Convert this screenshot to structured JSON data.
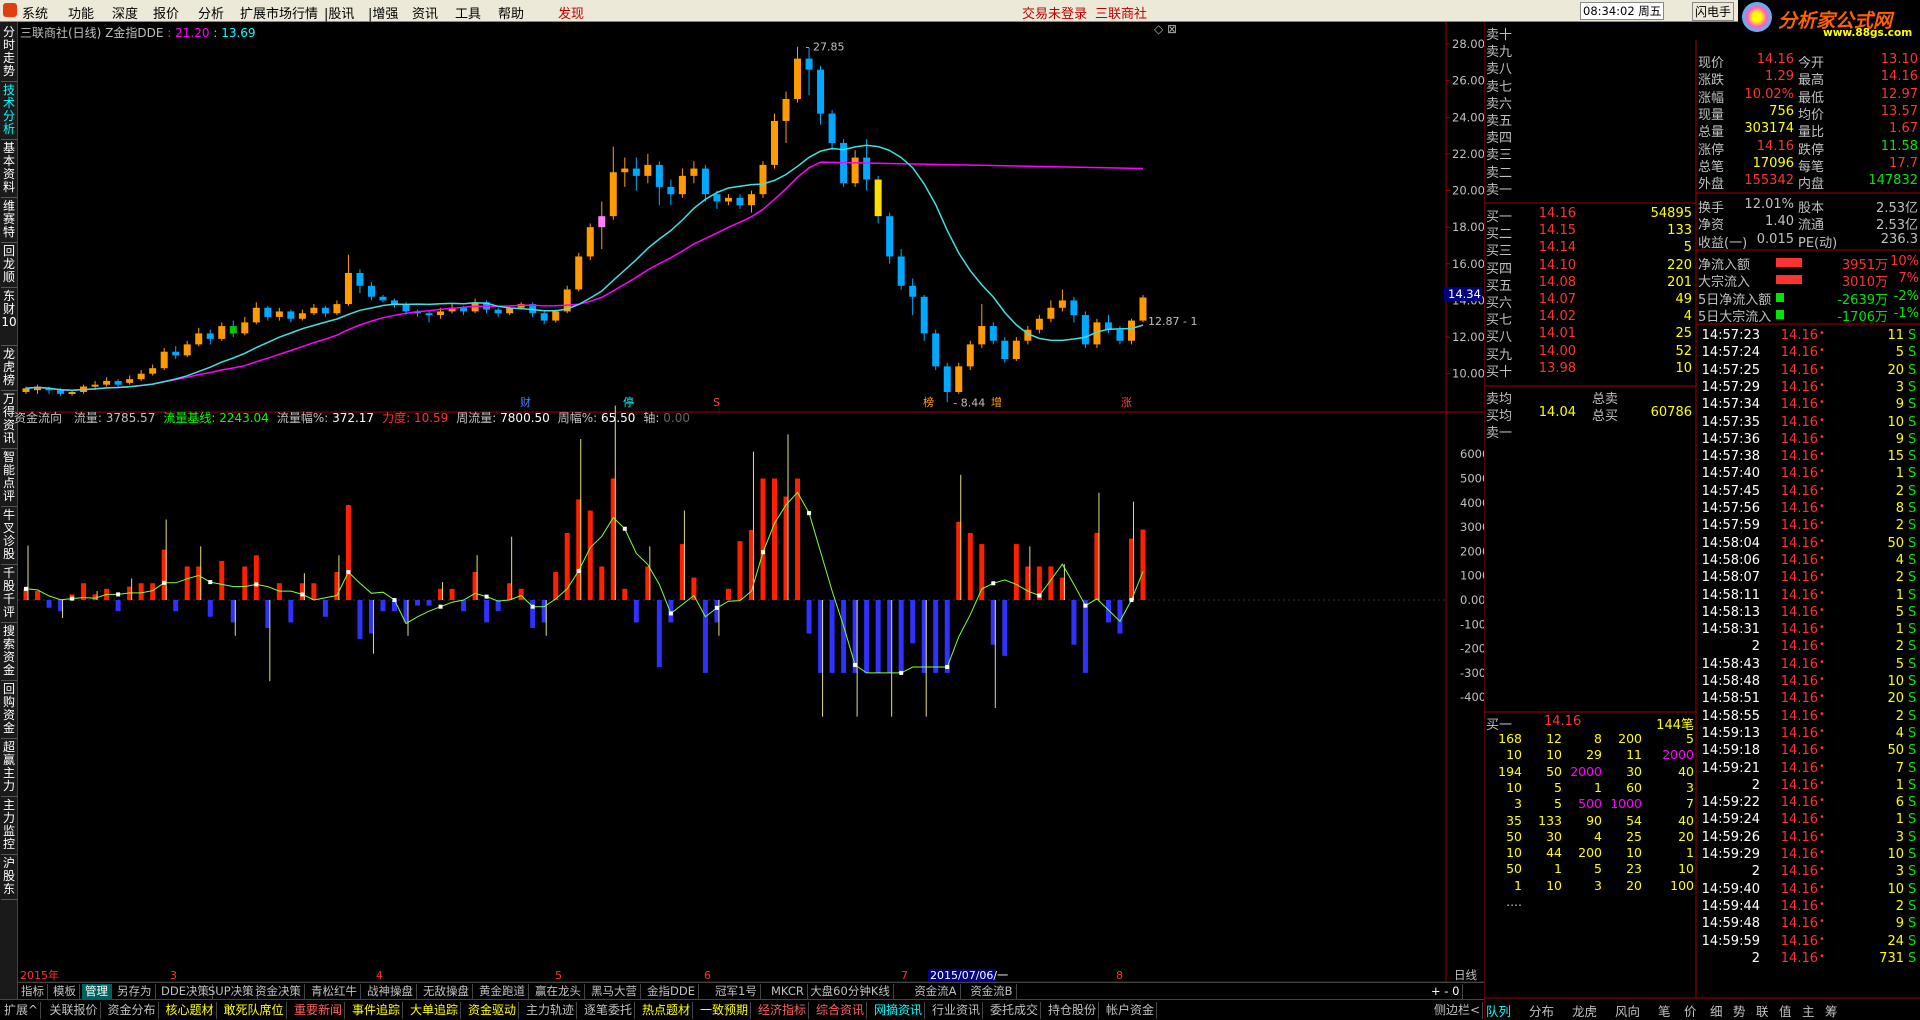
{
  "menu": {
    "items": [
      "系统",
      "功能",
      "深度",
      "报价",
      "分析",
      "扩展市场行情",
      "|股讯",
      "|增强",
      "资讯",
      "工具",
      "帮助"
    ],
    "discover": "发现",
    "login_status": "交易未登录",
    "broker": "三联商社",
    "time": "08:34:02 周五",
    "flash_btn": "闪电手",
    "last_btn": "行",
    "logo_text": "分析家公式网",
    "logo_url": "www.88gs.com"
  },
  "left_tabs": [
    "分时走势",
    "技术分析",
    "基本资料",
    "维赛特",
    "回龙顺",
    "东财10",
    "龙虎榜",
    "万得资讯",
    "智能点评",
    "牛叉诊股",
    "千股千评",
    "搜索资金",
    "回购资金",
    "超赢主力",
    "主力监控",
    "沪股东"
  ],
  "chart": {
    "title": "三联商社(日线) Z金指DDE",
    "ind1_label": ": 21.20",
    "ind2_label": ": 13.69",
    "price_axis": [
      "28.00",
      "26.00",
      "24.00",
      "22.00",
      "20.00",
      "18.00",
      "16.00",
      "14.00",
      "12.00",
      "10.00"
    ],
    "current_price": "14.34",
    "high_label": "27.85",
    "low_label": "8.44",
    "last_label": "12.87 - 1",
    "markers": [
      "财",
      "停",
      "S",
      "榜",
      "增",
      "涨"
    ],
    "lower_title": "资金流向",
    "lower_fields": [
      {
        "k": "流量:",
        "v": "3785.57",
        "c": "#c0c0c0"
      },
      {
        "k": "流量基线:",
        "v": "2243.04",
        "c": "#00ff00"
      },
      {
        "k": "流量幅%:",
        "v": "372.17",
        "c": "#ffffff"
      },
      {
        "k": "力度:",
        "v": "10.59",
        "c": "#ff3232"
      },
      {
        "k": "周流量:",
        "v": "7800.50",
        "c": "#ffffff"
      },
      {
        "k": "周幅%:",
        "v": "65.50",
        "c": "#ffffff"
      },
      {
        "k": "轴:",
        "v": "0.00",
        "c": "#666"
      }
    ],
    "flow_axis": [
      "6000",
      "5000",
      "4000",
      "3000",
      "2000",
      "1000",
      "0.00",
      "-1000",
      "-2000",
      "-3000",
      "-4000"
    ],
    "x_labels": [
      "2015年",
      "3",
      "4",
      "5",
      "6",
      "7",
      "2015/07/06/一",
      "8"
    ],
    "period": "日线"
  },
  "chart_data": {
    "type": "candlestick",
    "candles": [
      [
        9.0,
        9.2,
        8.9,
        9.3
      ],
      [
        9.1,
        9.3,
        8.9,
        9.4
      ],
      [
        9.2,
        9.1,
        8.9,
        9.3
      ],
      [
        9.1,
        8.9,
        8.8,
        9.2
      ],
      [
        8.9,
        9.0,
        8.8,
        9.1
      ],
      [
        9.0,
        9.3,
        8.9,
        9.4
      ],
      [
        9.3,
        9.4,
        9.1,
        9.6
      ],
      [
        9.4,
        9.6,
        9.3,
        9.8
      ],
      [
        9.6,
        9.4,
        9.3,
        9.7
      ],
      [
        9.5,
        9.7,
        9.4,
        9.9
      ],
      [
        9.7,
        10.0,
        9.6,
        10.2
      ],
      [
        10.0,
        10.3,
        9.9,
        10.5
      ],
      [
        10.3,
        11.2,
        10.2,
        11.4
      ],
      [
        11.2,
        11.0,
        10.8,
        11.5
      ],
      [
        11.0,
        11.6,
        10.9,
        11.8
      ],
      [
        11.6,
        12.2,
        11.5,
        12.5
      ],
      [
        12.2,
        11.9,
        11.6,
        12.4
      ],
      [
        11.9,
        12.6,
        11.8,
        12.8
      ],
      [
        12.6,
        12.2,
        12.0,
        12.9
      ],
      [
        12.2,
        12.8,
        12.1,
        13.1
      ],
      [
        12.8,
        13.6,
        12.7,
        13.9
      ],
      [
        13.6,
        13.1,
        12.9,
        13.7
      ],
      [
        13.1,
        13.4,
        12.9,
        13.6
      ],
      [
        13.4,
        13.0,
        12.8,
        13.5
      ],
      [
        13.0,
        13.3,
        12.9,
        13.5
      ],
      [
        13.3,
        13.6,
        13.2,
        13.8
      ],
      [
        13.6,
        13.3,
        13.1,
        13.7
      ],
      [
        13.3,
        13.8,
        13.2,
        14.0
      ],
      [
        13.8,
        15.5,
        13.7,
        16.5
      ],
      [
        15.5,
        14.8,
        14.4,
        15.7
      ],
      [
        14.8,
        14.2,
        14.0,
        15.0
      ],
      [
        14.2,
        14.0,
        13.9,
        14.3
      ],
      [
        14.0,
        13.8,
        13.6,
        14.1
      ],
      [
        13.8,
        13.4,
        13.2,
        13.9
      ],
      [
        13.4,
        13.3,
        13.1,
        13.5
      ],
      [
        13.3,
        13.2,
        12.8,
        13.4
      ],
      [
        13.2,
        13.4,
        13.0,
        13.6
      ],
      [
        13.4,
        13.6,
        13.3,
        13.8
      ],
      [
        13.6,
        13.4,
        13.2,
        13.7
      ],
      [
        13.4,
        13.9,
        13.3,
        14.1
      ],
      [
        13.9,
        13.5,
        13.3,
        14.0
      ],
      [
        13.5,
        13.3,
        13.1,
        13.6
      ],
      [
        13.3,
        13.6,
        13.2,
        13.7
      ],
      [
        13.6,
        13.8,
        13.5,
        13.9
      ],
      [
        13.8,
        13.3,
        13.1,
        13.9
      ],
      [
        13.3,
        12.9,
        12.7,
        13.4
      ],
      [
        12.9,
        13.4,
        12.8,
        13.5
      ],
      [
        13.4,
        14.6,
        13.3,
        14.8
      ],
      [
        14.6,
        16.4,
        14.5,
        16.6
      ],
      [
        16.4,
        18.0,
        16.2,
        18.2
      ],
      [
        18.0,
        18.6,
        16.8,
        19.4
      ],
      [
        18.6,
        21.0,
        18.4,
        22.4
      ],
      [
        21.0,
        21.2,
        20.2,
        21.8
      ],
      [
        21.2,
        20.8,
        20.0,
        21.8
      ],
      [
        20.8,
        21.4,
        20.4,
        22.0
      ],
      [
        21.4,
        20.2,
        19.2,
        21.6
      ],
      [
        20.2,
        19.8,
        19.2,
        20.6
      ],
      [
        19.8,
        20.8,
        19.6,
        21.2
      ],
      [
        20.8,
        21.2,
        20.4,
        21.6
      ],
      [
        21.2,
        19.8,
        19.4,
        21.4
      ],
      [
        19.8,
        19.4,
        19.0,
        20.0
      ],
      [
        19.4,
        19.6,
        19.2,
        19.8
      ],
      [
        19.6,
        19.2,
        19.0,
        19.8
      ],
      [
        19.2,
        19.8,
        18.8,
        20.0
      ],
      [
        19.8,
        21.4,
        19.6,
        21.6
      ],
      [
        21.4,
        23.8,
        21.2,
        24.2
      ],
      [
        23.8,
        25.0,
        22.6,
        25.4
      ],
      [
        25.0,
        27.2,
        24.8,
        27.85
      ],
      [
        27.2,
        26.6,
        25.2,
        27.8
      ],
      [
        26.6,
        24.2,
        23.6,
        26.8
      ],
      [
        24.2,
        22.6,
        22.2,
        24.4
      ],
      [
        22.6,
        20.4,
        20.2,
        22.8
      ],
      [
        20.4,
        21.8,
        20.2,
        22.2
      ],
      [
        21.8,
        20.6,
        20.0,
        22.8
      ],
      [
        20.6,
        18.6,
        18.2,
        20.8
      ],
      [
        18.6,
        16.4,
        16.0,
        18.8
      ],
      [
        16.4,
        14.8,
        14.6,
        16.8
      ],
      [
        14.8,
        14.2,
        13.2,
        15.2
      ],
      [
        14.2,
        12.2,
        11.8,
        14.3
      ],
      [
        12.2,
        10.4,
        10.2,
        12.4
      ],
      [
        10.4,
        9.0,
        8.44,
        10.6
      ],
      [
        9.0,
        10.4,
        8.9,
        10.6
      ],
      [
        10.4,
        11.6,
        10.2,
        11.8
      ],
      [
        11.6,
        12.6,
        11.4,
        13.8
      ],
      [
        12.6,
        11.8,
        11.6,
        12.8
      ],
      [
        11.8,
        10.8,
        10.6,
        12.0
      ],
      [
        10.8,
        11.8,
        10.7,
        12.0
      ],
      [
        11.8,
        12.4,
        11.6,
        12.6
      ],
      [
        12.4,
        13.0,
        12.2,
        13.2
      ],
      [
        13.0,
        13.6,
        12.8,
        14.0
      ],
      [
        13.6,
        14.0,
        13.4,
        14.6
      ],
      [
        14.0,
        13.2,
        12.8,
        14.2
      ],
      [
        13.2,
        11.6,
        11.4,
        13.4
      ],
      [
        11.6,
        12.8,
        11.4,
        13.0
      ],
      [
        12.8,
        12.4,
        12.2,
        13.2
      ],
      [
        12.4,
        11.8,
        11.6,
        12.6
      ],
      [
        11.8,
        12.9,
        11.6,
        13.0
      ],
      [
        12.9,
        14.16,
        12.8,
        14.3
      ]
    ],
    "flow": [
      800,
      300,
      -200,
      -300,
      -400,
      -200,
      -300,
      -600,
      -500,
      -300,
      -200,
      300,
      400,
      300,
      400,
      500,
      600,
      500,
      300,
      400,
      500,
      400,
      300,
      200,
      400,
      600,
      500,
      300,
      200,
      600,
      700,
      400,
      500,
      600,
      -200,
      -300,
      -400,
      -600,
      -500,
      -100,
      -200,
      -300,
      -100,
      -200,
      -50,
      -300,
      -400,
      -300,
      -200,
      -100,
      -400,
      -600,
      -1000,
      -300,
      -200,
      -200,
      -100,
      -300,
      -200,
      -200,
      -100,
      -400,
      -300,
      -400,
      -1200,
      -3000,
      -3600,
      -3000,
      -2800,
      -2400,
      -1400,
      -1000,
      -800,
      -700,
      -600,
      -500,
      -400,
      -300,
      -200,
      -100,
      -400,
      -300,
      -100,
      -200,
      -100,
      -300,
      200,
      100,
      -50,
      -200,
      -100,
      -300,
      -400,
      -200,
      -100,
      -200,
      -100
    ]
  },
  "quote": {
    "sell_levels": [
      "卖十",
      "卖九",
      "卖八",
      "卖七",
      "卖六",
      "卖五",
      "卖四",
      "卖三",
      "卖二",
      "卖一"
    ],
    "buy_levels": [
      {
        "name": "买一",
        "price": "14.16",
        "vol": "54895"
      },
      {
        "name": "买二",
        "price": "14.15",
        "vol": "133"
      },
      {
        "name": "买三",
        "price": "14.14",
        "vol": "5"
      },
      {
        "name": "买四",
        "price": "14.10",
        "vol": "220"
      },
      {
        "name": "买五",
        "price": "14.08",
        "vol": "201"
      },
      {
        "name": "买六",
        "price": "14.07",
        "vol": "49"
      },
      {
        "name": "买七",
        "price": "14.02",
        "vol": "4"
      },
      {
        "name": "买八",
        "price": "14.01",
        "vol": "25"
      },
      {
        "name": "买九",
        "price": "14.00",
        "vol": "52"
      },
      {
        "name": "买十",
        "price": "13.98",
        "vol": "10"
      }
    ],
    "sell_avg": "卖均",
    "total_sell": "总卖",
    "buy_avg": "买均",
    "buy_avg_price": "14.04",
    "total_buy": "总买",
    "total_buy_vol": "60786",
    "sell_one": "卖一",
    "buy_one_label": "买一",
    "buy_one_price": "14.16",
    "buy_one_count": "144笔",
    "queue": [
      [
        "168",
        "12",
        "8",
        "200",
        "5"
      ],
      [
        "10",
        "10",
        "29",
        "11",
        "2000"
      ],
      [
        "194",
        "50",
        "2000",
        "30",
        "40"
      ],
      [
        "10",
        "5",
        "1",
        "60",
        "3"
      ],
      [
        "3",
        "5",
        "500",
        "1000",
        "7"
      ],
      [
        "35",
        "133",
        "90",
        "54",
        "40"
      ],
      [
        "50",
        "30",
        "4",
        "25",
        "20"
      ],
      [
        "10",
        "44",
        "200",
        "10",
        "1"
      ],
      [
        "50",
        "1",
        "5",
        "23",
        "10"
      ],
      [
        "1",
        "10",
        "3",
        "20",
        "100"
      ],
      [
        "....",
        "",
        "",
        "",
        ""
      ]
    ],
    "stats": [
      {
        "k": "现价",
        "v": "14.16",
        "k2": "今开",
        "v2": "13.10"
      },
      {
        "k": "涨跌",
        "v": "1.29",
        "k2": "最高",
        "v2": "14.16"
      },
      {
        "k": "涨幅",
        "v": "10.02%",
        "k2": "最低",
        "v2": "12.97"
      },
      {
        "k": "现量",
        "v": "756",
        "k2": "均价",
        "v2": "13.57"
      },
      {
        "k": "总量",
        "v": "303174",
        "k2": "量比",
        "v2": "1.67"
      },
      {
        "k": "涨停",
        "v": "14.16",
        "k2": "跌停",
        "v2": "11.58"
      },
      {
        "k": "总笔",
        "v": "17096",
        "k2": "每笔",
        "v2": "17.7"
      },
      {
        "k": "外盘",
        "v": "155342",
        "k2": "内盘",
        "v2": "147832"
      }
    ],
    "stats2": [
      {
        "k": "换手",
        "v": "12.01%",
        "k2": "股本",
        "v2": "2.53亿"
      },
      {
        "k": "净资",
        "v": "1.40",
        "k2": "流通",
        "v2": "2.53亿"
      },
      {
        "k": "收益(一)",
        "v": "0.015",
        "k2": "PE(动)",
        "v2": "236.3"
      }
    ],
    "money_flow": [
      {
        "k": "净流入额",
        "v": "3951万",
        "p": "10%",
        "up": true
      },
      {
        "k": "大宗流入",
        "v": "3010万",
        "p": "7%",
        "up": true
      },
      {
        "k": "5日净流入额",
        "v": "-2639万",
        "p": "-2%",
        "up": false
      },
      {
        "k": "5日大宗流入",
        "v": "-1706万",
        "p": "-1%",
        "up": false
      }
    ],
    "ticks": [
      {
        "t": "14:57:23",
        "p": "14.16",
        "v": "11",
        "f": "S"
      },
      {
        "t": "14:57:24",
        "p": "14.16",
        "v": "5",
        "f": "S"
      },
      {
        "t": "14:57:25",
        "p": "14.16",
        "v": "20",
        "f": "S"
      },
      {
        "t": "14:57:29",
        "p": "14.16",
        "v": "3",
        "f": "S"
      },
      {
        "t": "14:57:34",
        "p": "14.16",
        "v": "9",
        "f": "S"
      },
      {
        "t": "14:57:35",
        "p": "14.16",
        "v": "10",
        "f": "S"
      },
      {
        "t": "14:57:36",
        "p": "14.16",
        "v": "9",
        "f": "S"
      },
      {
        "t": "14:57:38",
        "p": "14.16",
        "v": "15",
        "f": "S"
      },
      {
        "t": "14:57:40",
        "p": "14.16",
        "v": "1",
        "f": "S"
      },
      {
        "t": "14:57:45",
        "p": "14.16",
        "v": "2",
        "f": "S"
      },
      {
        "t": "14:57:56",
        "p": "14.16",
        "v": "8",
        "f": "S"
      },
      {
        "t": "14:57:59",
        "p": "14.16",
        "v": "2",
        "f": "S"
      },
      {
        "t": "14:58:04",
        "p": "14.16",
        "v": "50",
        "f": "S"
      },
      {
        "t": "14:58:06",
        "p": "14.16",
        "v": "4",
        "f": "S"
      },
      {
        "t": "14:58:07",
        "p": "14.16",
        "v": "2",
        "f": "S"
      },
      {
        "t": "14:58:11",
        "p": "14.16",
        "v": "1",
        "f": "S"
      },
      {
        "t": "14:58:13",
        "p": "14.16",
        "v": "5",
        "f": "S"
      },
      {
        "t": "14:58:31",
        "p": "14.16",
        "v": "1",
        "f": "S"
      },
      {
        "t": "2",
        "p": "14.16",
        "v": "2",
        "f": "S"
      },
      {
        "t": "14:58:43",
        "p": "14.16",
        "v": "5",
        "f": "S"
      },
      {
        "t": "14:58:48",
        "p": "14.16",
        "v": "10",
        "f": "S"
      },
      {
        "t": "14:58:51",
        "p": "14.16",
        "v": "20",
        "f": "S"
      },
      {
        "t": "14:58:55",
        "p": "14.16",
        "v": "2",
        "f": "S"
      },
      {
        "t": "14:59:13",
        "p": "14.16",
        "v": "4",
        "f": "S"
      },
      {
        "t": "14:59:18",
        "p": "14.16",
        "v": "50",
        "f": "S"
      },
      {
        "t": "14:59:21",
        "p": "14.16",
        "v": "7",
        "f": "S"
      },
      {
        "t": "2",
        "p": "14.16",
        "v": "1",
        "f": "S"
      },
      {
        "t": "14:59:22",
        "p": "14.16",
        "v": "6",
        "f": "S"
      },
      {
        "t": "14:59:24",
        "p": "14.16",
        "v": "1",
        "f": "S"
      },
      {
        "t": "14:59:26",
        "p": "14.16",
        "v": "3",
        "f": "S"
      },
      {
        "t": "14:59:29",
        "p": "14.16",
        "v": "10",
        "f": "S"
      },
      {
        "t": "2",
        "p": "14.16",
        "v": "3",
        "f": "S"
      },
      {
        "t": "14:59:40",
        "p": "14.16",
        "v": "10",
        "f": "S"
      },
      {
        "t": "14:59:44",
        "p": "14.16",
        "v": "2",
        "f": "S"
      },
      {
        "t": "14:59:48",
        "p": "14.16",
        "v": "9",
        "f": "S"
      },
      {
        "t": "14:59:59",
        "p": "14.16",
        "v": "24",
        "f": "S"
      },
      {
        "t": "2",
        "p": "14.16",
        "v": "731",
        "f": "S"
      }
    ],
    "rp_tabs": [
      "队列",
      "分布",
      "龙虎",
      "风向",
      "笔",
      "价",
      "细",
      "势",
      "联",
      "值",
      "主",
      "筹"
    ]
  },
  "tabs1": [
    "指标",
    "模板",
    "管理",
    "另存为",
    "DDE决策",
    "SUP决策",
    "资金决策",
    "青松红牛",
    "战神操盘",
    "无敌操盘",
    "黄金跑道",
    "赢在龙头",
    "黑马大营",
    "金指DDE",
    "冠军1号",
    "MKCR",
    "大盘60分钟K线",
    "资金流A",
    "资金流B"
  ],
  "tabs2": [
    "扩展^",
    "关联报价",
    "资金分布",
    "核心题材",
    "敢死队席位",
    "重要新闻",
    "事件追踪",
    "大单追踪",
    "资金驱动",
    "主力轨迹",
    "逐笔委托",
    "热点题材",
    "一致预期",
    "经济指标",
    "综合资讯",
    "网摘资讯",
    "行业资讯",
    "委托成交",
    "持仓股份",
    "帐户资金"
  ],
  "side_label": "侧边栏<"
}
